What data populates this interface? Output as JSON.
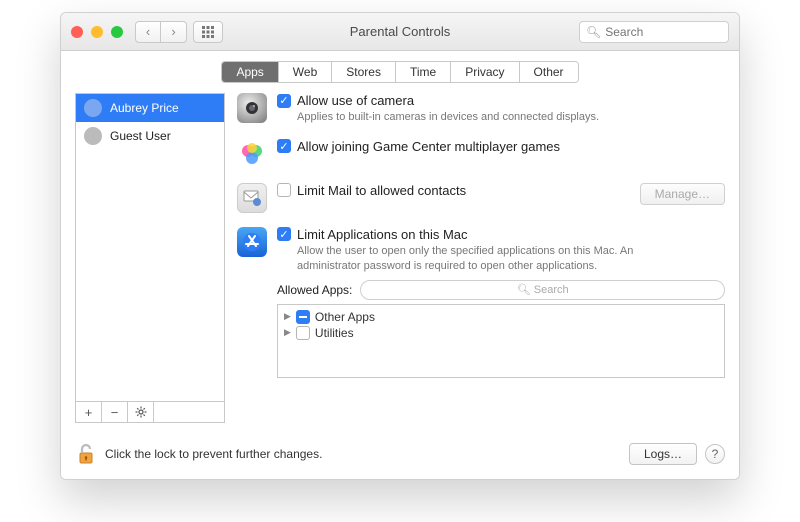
{
  "window": {
    "title": "Parental Controls"
  },
  "toolbar": {
    "search_placeholder": "Search"
  },
  "tabs": [
    "Apps",
    "Web",
    "Stores",
    "Time",
    "Privacy",
    "Other"
  ],
  "selected_tab": "Apps",
  "users": [
    {
      "name": "Aubrey Price",
      "selected": true
    },
    {
      "name": "Guest User",
      "selected": false
    }
  ],
  "options": {
    "camera": {
      "label": "Allow use of camera",
      "desc": "Applies to built-in cameras in devices and connected displays.",
      "checked": true
    },
    "gamecenter": {
      "label": "Allow joining Game Center multiplayer games",
      "checked": true
    },
    "mail": {
      "label": "Limit Mail to allowed contacts",
      "checked": false,
      "manage_label": "Manage…"
    },
    "limitapps": {
      "label": "Limit Applications on this Mac",
      "desc": "Allow the user to open only the specified applications on this Mac. An administrator password is required to open other applications.",
      "checked": true
    }
  },
  "allowed": {
    "label": "Allowed Apps:",
    "search_placeholder": "Search",
    "items": [
      {
        "label": "Other Apps",
        "state": "mixed"
      },
      {
        "label": "Utilities",
        "state": "off"
      }
    ]
  },
  "footer": {
    "lock_text": "Click the lock to prevent further changes.",
    "logs_label": "Logs…",
    "help_label": "?"
  }
}
